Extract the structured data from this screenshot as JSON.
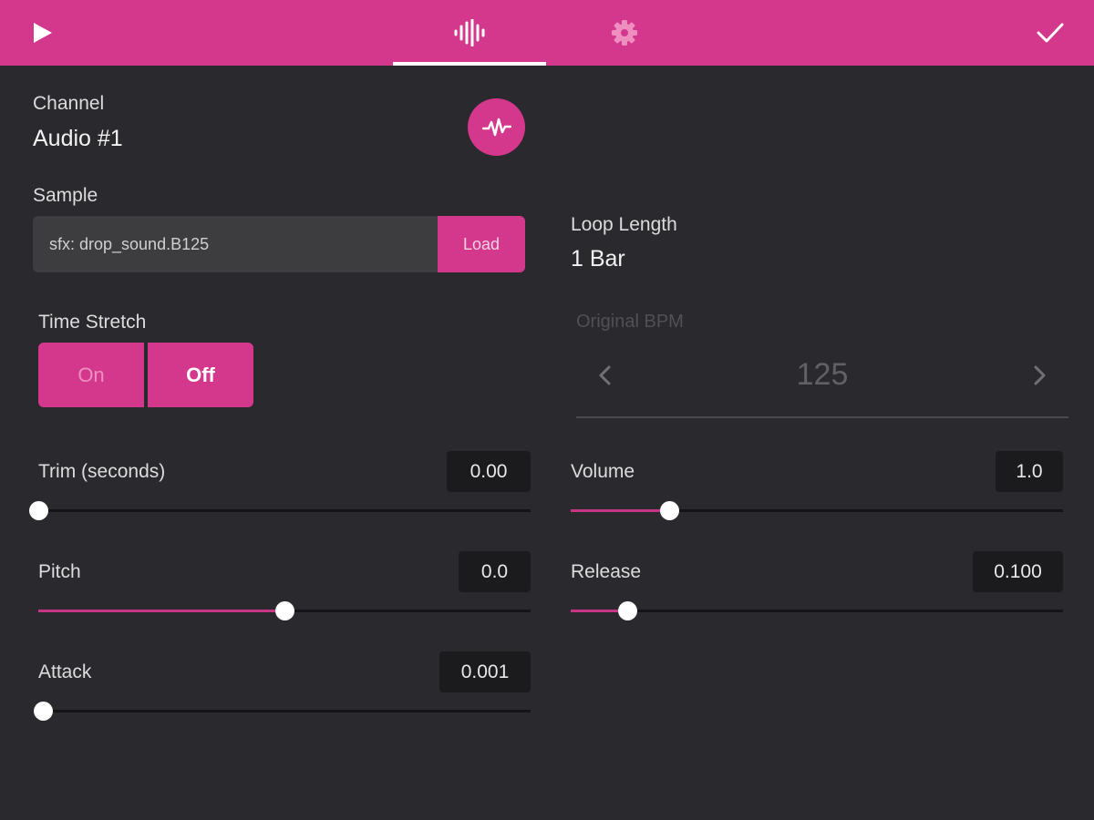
{
  "icons": {
    "play": "play-icon",
    "audio_tab": "waveform-bars-icon",
    "settings_tab": "gear-icon",
    "done": "checkmark-icon",
    "waveform": "waveform-icon",
    "bpm_prev": "chevron-left-icon",
    "bpm_next": "chevron-right-icon"
  },
  "colors": {
    "accent": "#d4388c",
    "background": "#2a2a2e"
  },
  "channel": {
    "label": "Channel",
    "value": "Audio #1"
  },
  "sample": {
    "label": "Sample",
    "value": "sfx: drop_sound.B125",
    "load_label": "Load"
  },
  "loop_length": {
    "label": "Loop Length",
    "value": "1 Bar"
  },
  "time_stretch": {
    "label": "Time Stretch",
    "on_label": "On",
    "off_label": "Off",
    "selected": "Off"
  },
  "original_bpm": {
    "label": "Original BPM",
    "value": "125"
  },
  "sliders": {
    "trim": {
      "label": "Trim (seconds)",
      "value": "0.00",
      "fraction": 0.0
    },
    "pitch": {
      "label": "Pitch",
      "value": "0.0",
      "fraction": 0.5
    },
    "attack": {
      "label": "Attack",
      "value": "0.001",
      "fraction": 0.01
    },
    "volume": {
      "label": "Volume",
      "value": "1.0",
      "fraction": 0.2
    },
    "release": {
      "label": "Release",
      "value": "0.100",
      "fraction": 0.115
    }
  }
}
